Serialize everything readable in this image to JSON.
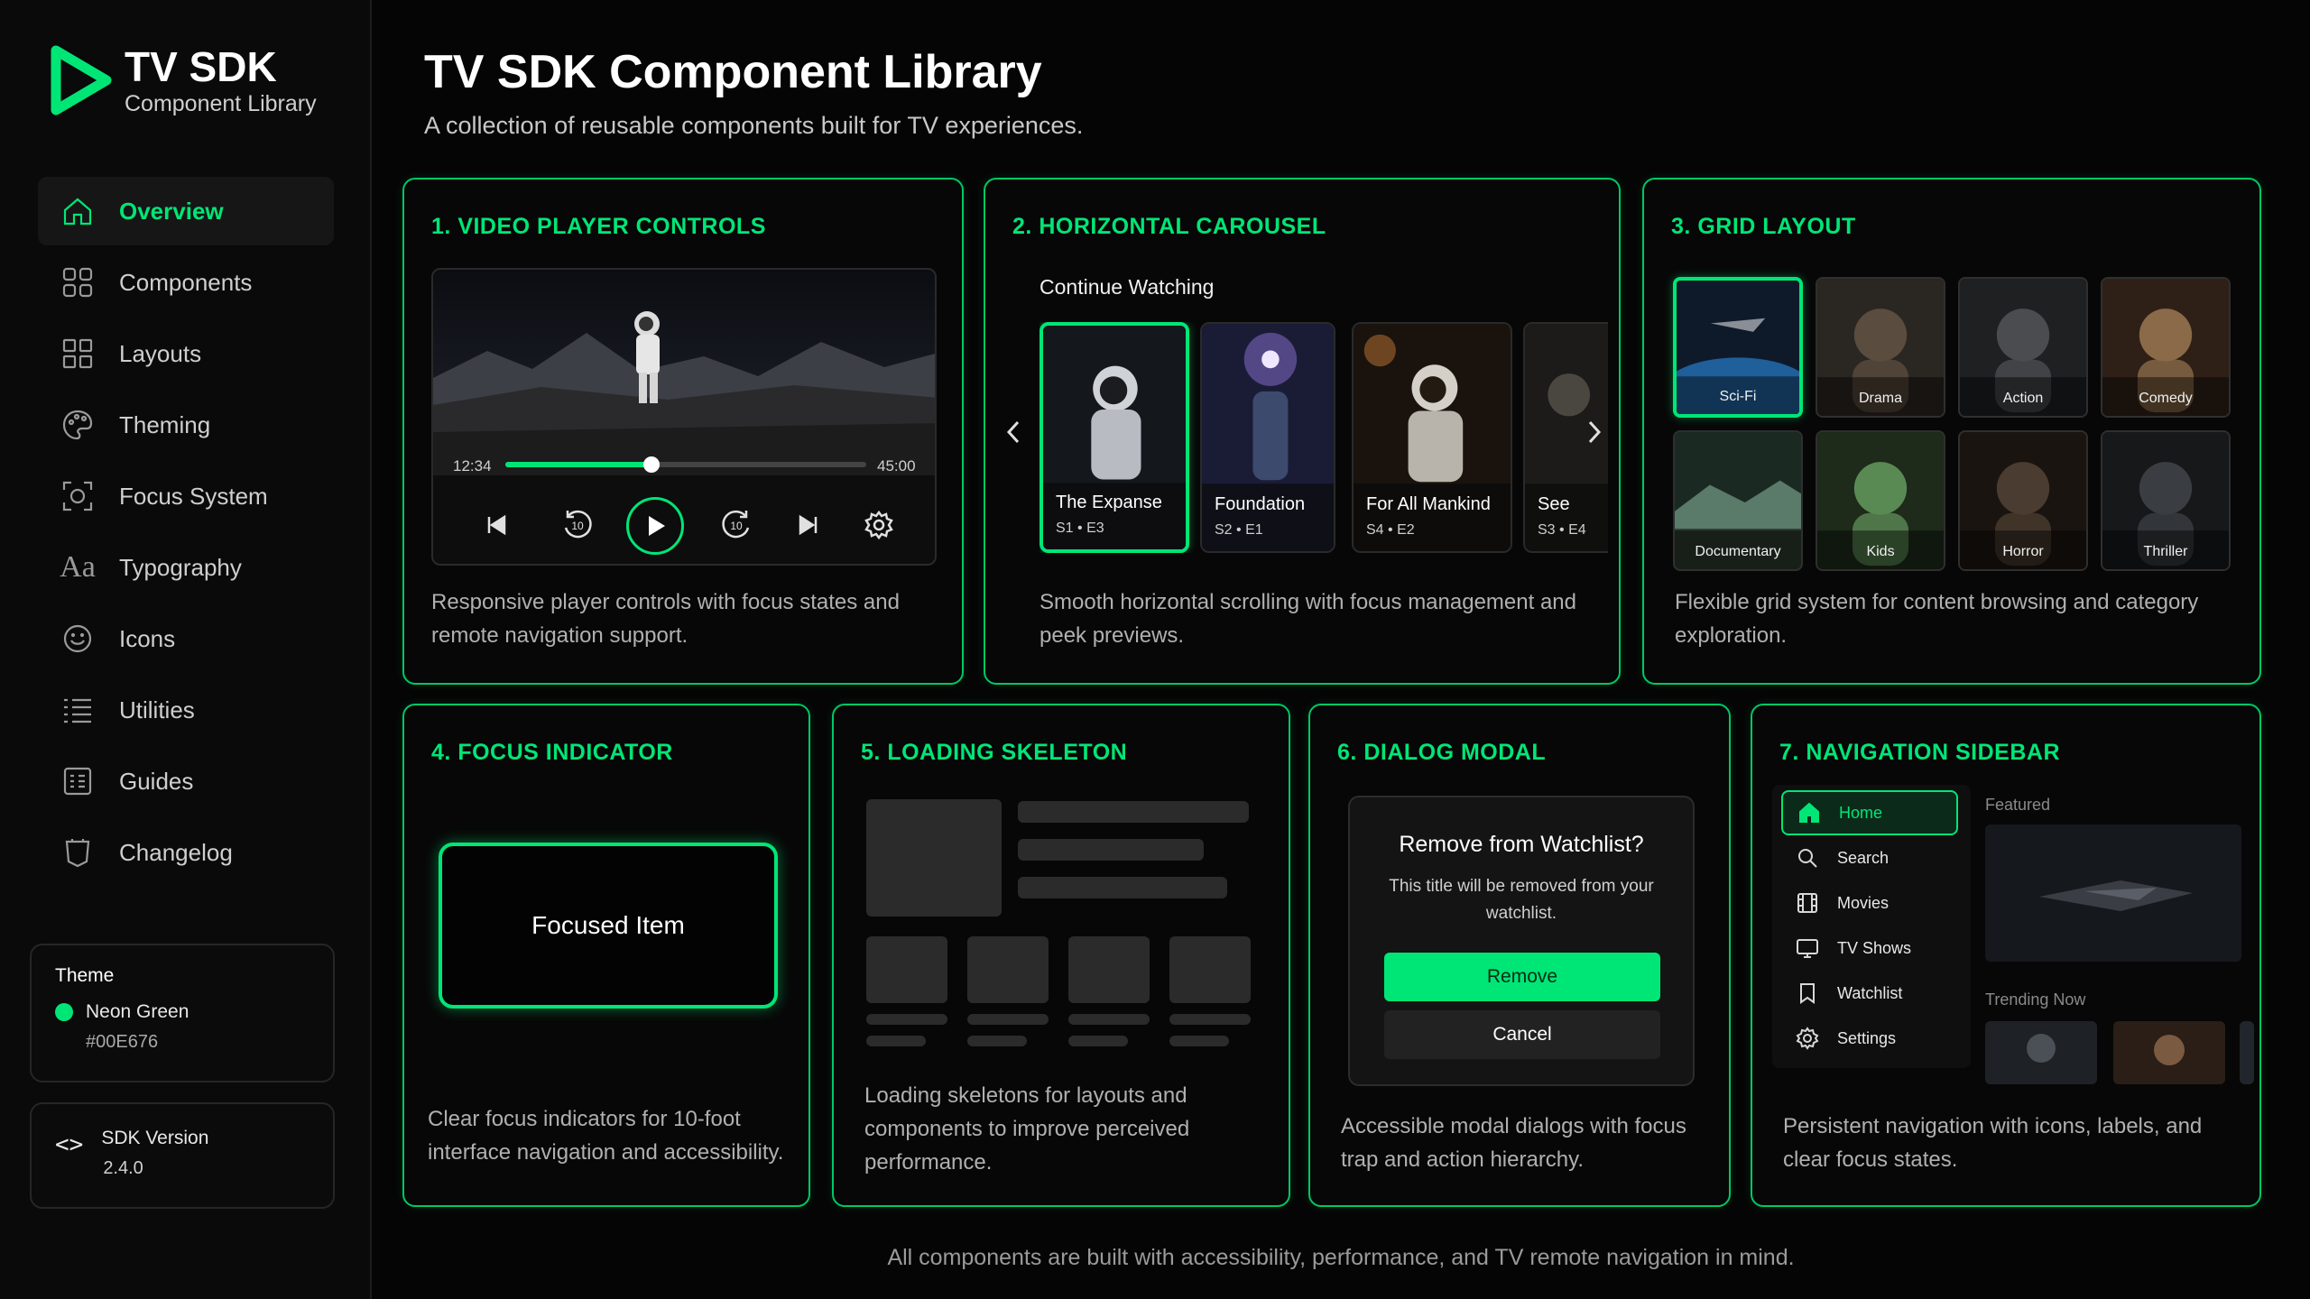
{
  "brand": {
    "title": "TV SDK",
    "subtitle": "Component Library"
  },
  "sidebar": {
    "items": [
      {
        "label": "Overview",
        "icon": "home-icon",
        "active": true
      },
      {
        "label": "Components",
        "icon": "grid-icon"
      },
      {
        "label": "Layouts",
        "icon": "layout-icon"
      },
      {
        "label": "Theming",
        "icon": "palette-icon"
      },
      {
        "label": "Focus System",
        "icon": "focus-icon"
      },
      {
        "label": "Typography",
        "icon": "typography-icon"
      },
      {
        "label": "Icons",
        "icon": "smiley-icon"
      },
      {
        "label": "Utilities",
        "icon": "list-icon"
      },
      {
        "label": "Guides",
        "icon": "guide-icon"
      },
      {
        "label": "Changelog",
        "icon": "changelog-icon"
      }
    ],
    "theme": {
      "title": "Theme",
      "name": "Neon Green",
      "hex": "#00E676"
    },
    "version": {
      "label": "SDK Version",
      "value": "2.4.0"
    }
  },
  "header": {
    "title": "TV SDK Component Library",
    "subtitle": "A collection of reusable components built for TV experiences."
  },
  "cards": {
    "video": {
      "number": "1.",
      "title": "VIDEO PLAYER CONTROLS",
      "time_current": "12:34",
      "time_total": "45:00",
      "progress": 0.405,
      "skip_back": "10",
      "skip_forward": "10",
      "desc": "Responsive player controls with focus states and remote navigation support."
    },
    "carousel": {
      "number": "2.",
      "title": "HORIZONTAL CAROUSEL",
      "heading": "Continue Watching",
      "tiles": [
        {
          "name": "The Expanse",
          "ep": "S1 • E3"
        },
        {
          "name": "Foundation",
          "ep": "S2 • E1"
        },
        {
          "name": "For All Mankind",
          "ep": "S4 • E2"
        },
        {
          "name": "See",
          "ep": "S3 • E4"
        }
      ],
      "desc": "Smooth horizontal scrolling with focus management and peek previews."
    },
    "grid": {
      "number": "3.",
      "title": "GRID LAYOUT",
      "tiles": [
        "Sci-Fi",
        "Drama",
        "Action",
        "Comedy",
        "Documentary",
        "Kids",
        "Horror",
        "Thriller"
      ],
      "desc": "Flexible grid system for content browsing and category exploration."
    },
    "focus": {
      "number": "4.",
      "title": "FOCUS INDICATOR",
      "item": "Focused Item",
      "desc": "Clear focus indicators for 10-foot interface navigation and accessibility."
    },
    "skeleton": {
      "number": "5.",
      "title": "LOADING SKELETON",
      "desc": "Loading skeletons for layouts and components to improve perceived performance."
    },
    "dialog": {
      "number": "6.",
      "title": "DIALOG MODAL",
      "heading": "Remove from Watchlist?",
      "body": "This title will be removed from your watchlist.",
      "primary": "Remove",
      "secondary": "Cancel",
      "desc": "Accessible modal dialogs with focus trap and action hierarchy."
    },
    "navsidebar": {
      "number": "7.",
      "title": "NAVIGATION SIDEBAR",
      "items": [
        "Home",
        "Search",
        "Movies",
        "TV Shows",
        "Watchlist",
        "Settings"
      ],
      "featured": "Featured",
      "trending": "Trending Now",
      "desc": "Persistent navigation with icons, labels, and clear focus states."
    }
  },
  "footer": "All components are built with accessibility, performance, and TV remote navigation in mind.",
  "colors": {
    "accent": "#00E676",
    "background": "#050505"
  }
}
